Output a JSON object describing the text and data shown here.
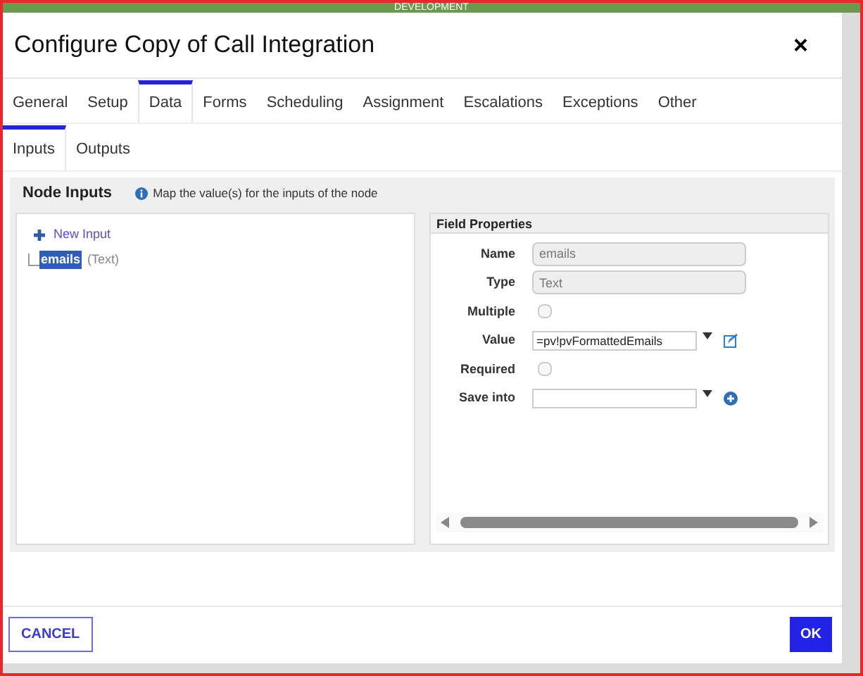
{
  "banner": {
    "text": "DEVELOPMENT"
  },
  "dialog": {
    "title": "Configure Copy of Call Integration",
    "close": "×"
  },
  "tabs": [
    {
      "label": "General",
      "selected": false
    },
    {
      "label": "Setup",
      "selected": false
    },
    {
      "label": "Data",
      "selected": true
    },
    {
      "label": "Forms",
      "selected": false
    },
    {
      "label": "Scheduling",
      "selected": false
    },
    {
      "label": "Assignment",
      "selected": false
    },
    {
      "label": "Escalations",
      "selected": false
    },
    {
      "label": "Exceptions",
      "selected": false
    },
    {
      "label": "Other",
      "selected": false
    }
  ],
  "subtabs": [
    {
      "label": "Inputs",
      "selected": true
    },
    {
      "label": "Outputs",
      "selected": false
    }
  ],
  "section": {
    "title": "Node Inputs",
    "hint": "Map the value(s) for the inputs of the node"
  },
  "tree": {
    "new_input": "New Input",
    "items": [
      {
        "name": "emails",
        "type": "(Text)",
        "selected": true
      }
    ]
  },
  "properties": {
    "title": "Field Properties",
    "rows": [
      {
        "kind": "text",
        "label": "Name",
        "value": "emails",
        "disabled": true
      },
      {
        "kind": "text",
        "label": "Type",
        "value": "Text",
        "disabled": true
      },
      {
        "kind": "checkbox",
        "label": "Multiple",
        "checked": false
      },
      {
        "kind": "expression",
        "label": "Value",
        "value": "=pv!pvFormattedEmails"
      },
      {
        "kind": "checkbox",
        "label": "Required",
        "checked": false
      },
      {
        "kind": "select",
        "label": "Save into",
        "value": ""
      }
    ]
  },
  "buttons": {
    "cancel": "CANCEL",
    "ok": "OK"
  }
}
